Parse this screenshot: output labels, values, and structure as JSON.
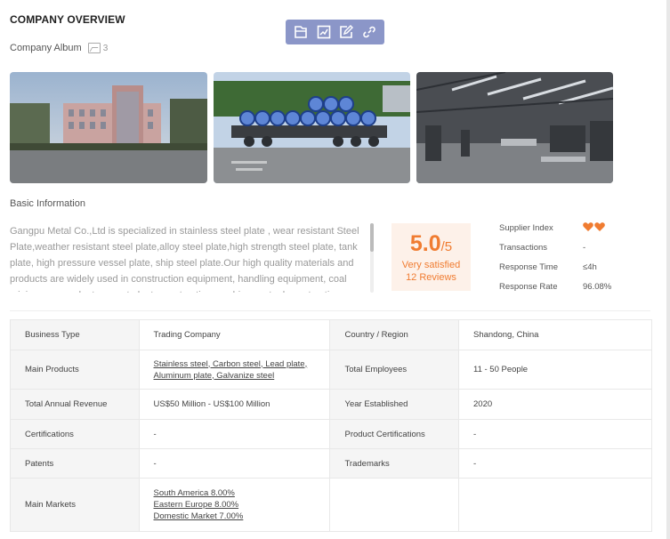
{
  "overview": {
    "title": "COMPANY OVERVIEW"
  },
  "album": {
    "label": "Company Album",
    "count": "3"
  },
  "toolbar": {
    "icons": [
      "file-icon",
      "chart-icon",
      "edit-icon",
      "link-icon"
    ]
  },
  "basic": {
    "label": "Basic Information",
    "description": "Gangpu Metal Co.,Ltd is specialized in stainless steel plate , wear resistant Steel Plate,weather resistant steel plate,alloy steel plate,high strength steel plate, tank plate, high pressure vessel plate, ship steel plate.Our high quality materials and products are widely used in construction equipment, handling equipment, coal mining, power plant,cement plant, construction machinery, steel construction,"
  },
  "rating": {
    "score": "5.0",
    "denominator": "/5",
    "satisfaction": "Very satisfied",
    "reviews": "12 Reviews"
  },
  "stats": {
    "supplier_index_label": "Supplier Index",
    "transactions_label": "Transactions",
    "transactions_value": "-",
    "response_time_label": "Response Time",
    "response_time_value": "≤4h",
    "response_rate_label": "Response Rate",
    "response_rate_value": "96.08%",
    "accent_color": "#f07c31"
  },
  "table": {
    "business_type_label": "Business Type",
    "business_type_value": "Trading Company",
    "country_label": "Country / Region",
    "country_value": "Shandong, China",
    "main_products_label": "Main Products",
    "main_products_line1": "Stainless steel, Carbon steel, Lead plate,",
    "main_products_line2": "Aluminum plate, Galvanize steel",
    "employees_label": "Total Employees",
    "employees_value": "11 - 50 People",
    "revenue_label": "Total Annual Revenue",
    "revenue_value": "US$50 Million - US$100 Million",
    "year_label": "Year Established",
    "year_value": "2020",
    "certifications_label": "Certifications",
    "certifications_value": "-",
    "product_cert_label": "Product Certifications",
    "product_cert_value": "-",
    "patents_label": "Patents",
    "patents_value": "-",
    "trademarks_label": "Trademarks",
    "trademarks_value": "-",
    "markets_label": "Main Markets",
    "markets": [
      "South America 8.00%",
      "Eastern Europe 8.00%",
      "Domestic Market 7.00%"
    ]
  }
}
